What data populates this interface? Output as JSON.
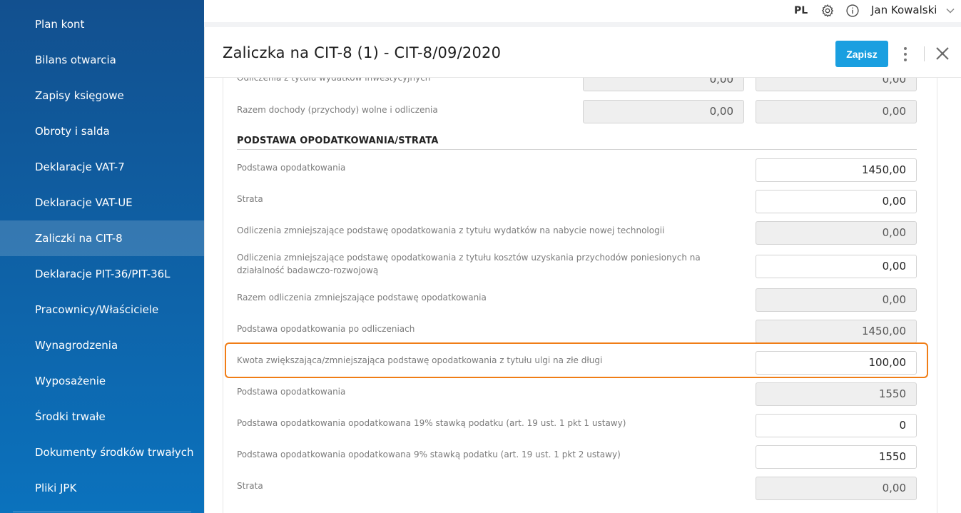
{
  "sidebar": {
    "items": [
      {
        "label": "Plan kont"
      },
      {
        "label": "Bilans otwarcia"
      },
      {
        "label": "Zapisy księgowe"
      },
      {
        "label": "Obroty i salda"
      },
      {
        "label": "Deklaracje VAT-7"
      },
      {
        "label": "Deklaracje VAT-UE"
      },
      {
        "label": "Zaliczki na CIT-8",
        "active": true
      },
      {
        "label": "Deklaracje PIT-36/PIT-36L"
      },
      {
        "label": "Pracownicy/Właściciele"
      },
      {
        "label": "Wynagrodzenia"
      },
      {
        "label": "Wyposażenie"
      },
      {
        "label": "Środki trwałe"
      },
      {
        "label": "Dokumenty środków trwałych"
      },
      {
        "label": "Pliki JPK"
      }
    ]
  },
  "topbar": {
    "lang": "PL",
    "user": "Jan Kowalski",
    "icons": [
      "gear-icon",
      "info-icon",
      "chevron-down-icon"
    ]
  },
  "panel": {
    "title": "Zaliczka na CIT-8 (1) - CIT-8/09/2020",
    "save_label": "Zapisz"
  },
  "form": {
    "top_rows": [
      {
        "label": "Odliczenia z tytułu wydatków inwestycyjnych",
        "v1": "0,00",
        "v2": "0,00"
      },
      {
        "label": "Razem dochody (przychody) wolne i odliczenia",
        "v1": "0,00",
        "v2": "0,00"
      }
    ],
    "section_title": "PODSTAWA OPODATKOWANIA/STRATA",
    "rows": [
      {
        "label": "Podstawa opodatkowania",
        "value": "1450,00",
        "readonly": false
      },
      {
        "label": "Strata",
        "value": "0,00",
        "readonly": false
      },
      {
        "label": "Odliczenia zmniejszające podstawę opodatkowania z tytułu wydatków na nabycie nowej technologii",
        "value": "0,00",
        "readonly": true
      },
      {
        "label": "Odliczenia zmniejszające podstawę opodatkowania z tytułu kosztów uzyskania przychodów poniesionych na działalność badawczo-rozwojową",
        "value": "0,00",
        "readonly": false
      },
      {
        "label": "Razem odliczenia zmniejszające podstawę opodatkowania",
        "value": "0,00",
        "readonly": true
      },
      {
        "label": "Podstawa opodatkowania po odliczeniach",
        "value": "1450,00",
        "readonly": true
      },
      {
        "label": "Kwota zwiększająca/zmniejszająca podstawę opodatkowania z tytułu ulgi na złe długi",
        "value": "100,00",
        "readonly": false,
        "highlighted": true
      },
      {
        "label": "Podstawa opodatkowania",
        "value": "1550",
        "readonly": true
      },
      {
        "label": "Podstawa opodatkowania opodatkowana 19% stawką podatku (art. 19 ust. 1 pkt 1 ustawy)",
        "value": "0",
        "readonly": false
      },
      {
        "label": "Podstawa opodatkowania opodatkowana 9% stawką podatku (art. 19 ust. 1 pkt 2 ustawy)",
        "value": "1550",
        "readonly": false
      },
      {
        "label": "Strata",
        "value": "0,00",
        "readonly": true
      }
    ]
  },
  "colors": {
    "sidebar_top": "#12508f",
    "sidebar_bottom": "#0b72bd",
    "accent": "#1a9fe0",
    "highlight": "#f07d16"
  }
}
